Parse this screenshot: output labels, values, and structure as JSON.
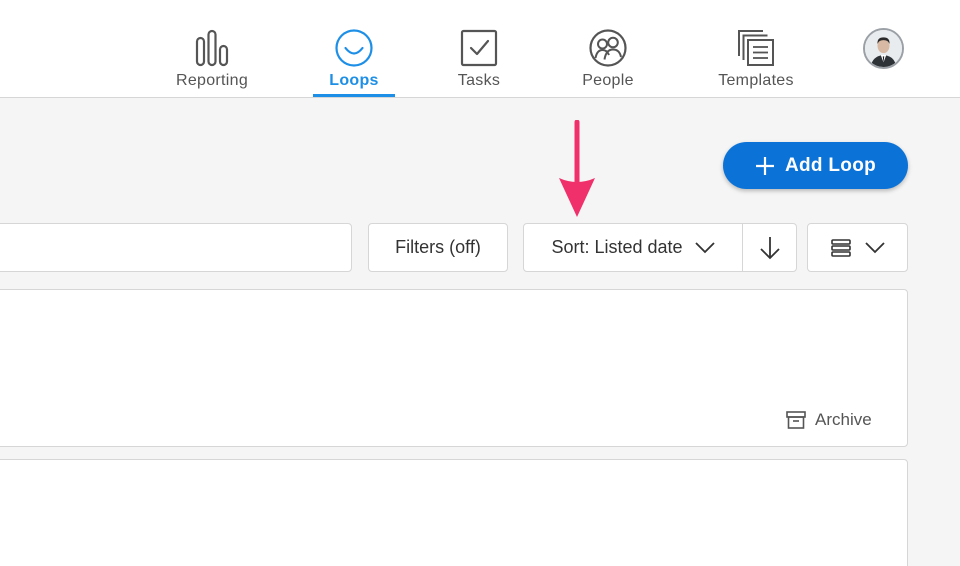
{
  "nav": {
    "items": [
      {
        "label": "Reporting",
        "icon": "bar-chart-icon",
        "active": false
      },
      {
        "label": "Loops",
        "icon": "smile-icon",
        "active": true
      },
      {
        "label": "Tasks",
        "icon": "checkbox-icon",
        "active": false
      },
      {
        "label": "People",
        "icon": "people-icon",
        "active": false
      },
      {
        "label": "Templates",
        "icon": "templates-icon",
        "active": false
      }
    ],
    "avatar_icon": "user-avatar-icon"
  },
  "actions": {
    "add_loop_label": "Add Loop",
    "add_icon": "plus-icon"
  },
  "toolbar": {
    "search_value": "",
    "filters_label": "Filters (off)",
    "sort_label": "Sort: Listed date",
    "sort_dropdown_icon": "chevron-down-icon",
    "sort_direction_icon": "arrow-down-icon",
    "view_icon": "list-view-icon",
    "view_dropdown_icon": "chevron-down-icon"
  },
  "cards": {
    "archive_label": "Archive",
    "archive_icon": "archive-box-icon"
  },
  "annotation": {
    "arrow_color": "#f0306b",
    "arrow_icon": "pointer-arrow-icon"
  },
  "colors": {
    "accent": "#1d8fe6",
    "primary_button": "#0b73d8"
  }
}
